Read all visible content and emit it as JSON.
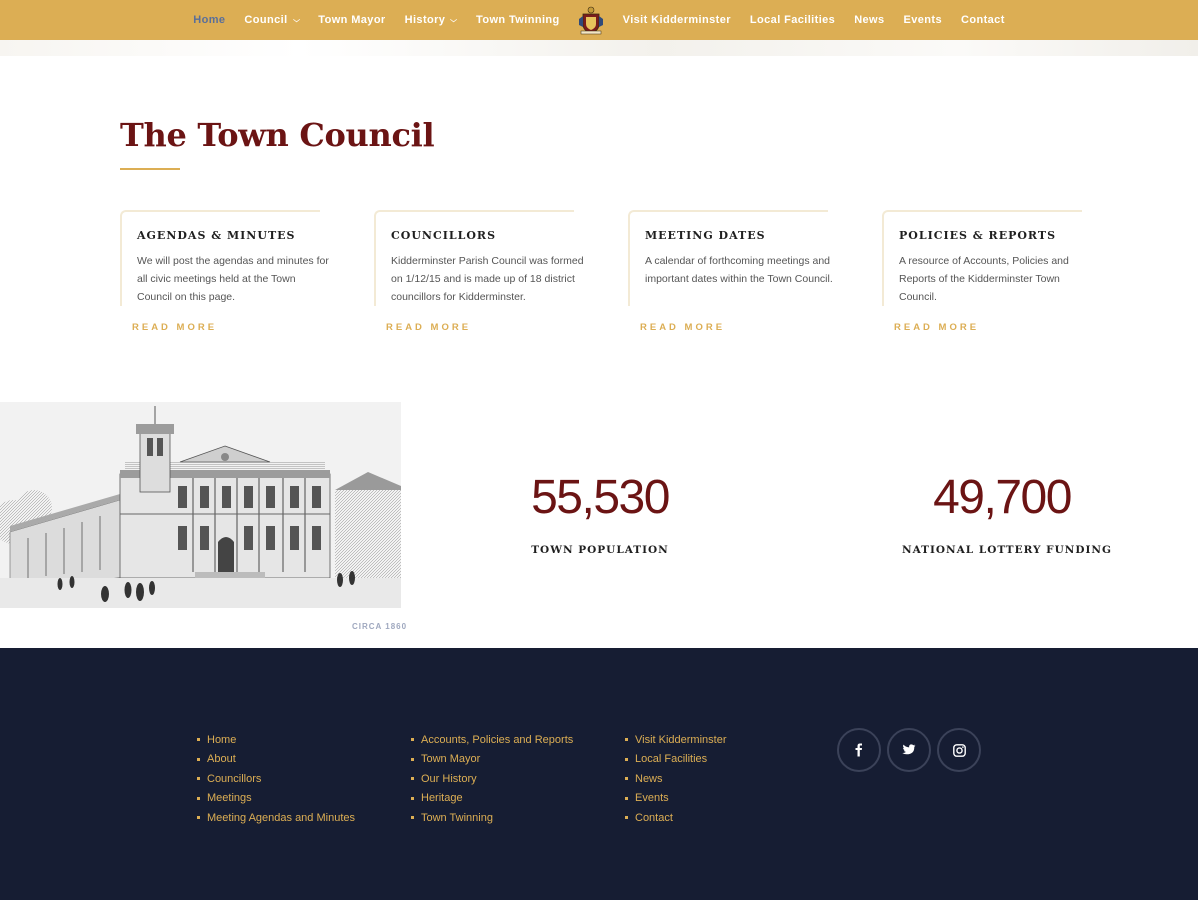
{
  "nav": {
    "left": [
      {
        "label": "Home",
        "active": true,
        "dropdown": false
      },
      {
        "label": "Council",
        "active": false,
        "dropdown": true
      },
      {
        "label": "Town Mayor",
        "active": false,
        "dropdown": false
      },
      {
        "label": "History",
        "active": false,
        "dropdown": true
      },
      {
        "label": "Town Twinning",
        "active": false,
        "dropdown": false
      }
    ],
    "right": [
      {
        "label": "Visit Kidderminster"
      },
      {
        "label": "Local Facilities"
      },
      {
        "label": "News"
      },
      {
        "label": "Events"
      },
      {
        "label": "Contact"
      }
    ],
    "crest_icon": "crest-logo-icon"
  },
  "main": {
    "title": "The Town Council",
    "cards": [
      {
        "title": "AGENDAS & MINUTES",
        "text": "We will post the agendas and minutes for all civic meetings held at the Town Council on this page.",
        "link": "READ MORE"
      },
      {
        "title": "COUNCILLORS",
        "text": "Kidderminster Parish Council was formed on 1/12/15 and is made up of 18 district councillors for Kidderminster.",
        "link": "READ MORE"
      },
      {
        "title": "MEETING DATES",
        "text": "A calendar of forthcoming meetings and important dates within the Town Council.",
        "link": "READ MORE"
      },
      {
        "title": "POLICIES & REPORTS",
        "text": "A resource of Accounts, Policies and Reports of the Kidderminster Town Council.",
        "link": "READ MORE"
      }
    ],
    "image_caption": "CIRCA 1860",
    "stats": [
      {
        "value": "55,530",
        "label": "TOWN POPULATION"
      },
      {
        "value": "49,700",
        "label": "NATIONAL LOTTERY FUNDING"
      }
    ]
  },
  "footer": {
    "col1": [
      "Home",
      "About",
      "Councillors",
      "Meetings",
      "Meeting Agendas and Minutes"
    ],
    "col2": [
      "Accounts, Policies and Reports",
      "Town Mayor",
      "Our History",
      "Heritage",
      "Town Twinning"
    ],
    "col3": [
      "Visit Kidderminster",
      "Local Facilities",
      "News",
      "Events",
      "Contact"
    ],
    "social": [
      {
        "icon": "facebook-icon"
      },
      {
        "icon": "twitter-icon"
      },
      {
        "icon": "instagram-icon"
      }
    ]
  },
  "colors": {
    "nav_bg": "#dcae54",
    "accent": "#dcae54",
    "title": "#6b1414",
    "footer_bg": "#161d33",
    "active_nav": "#5a6f9a"
  }
}
